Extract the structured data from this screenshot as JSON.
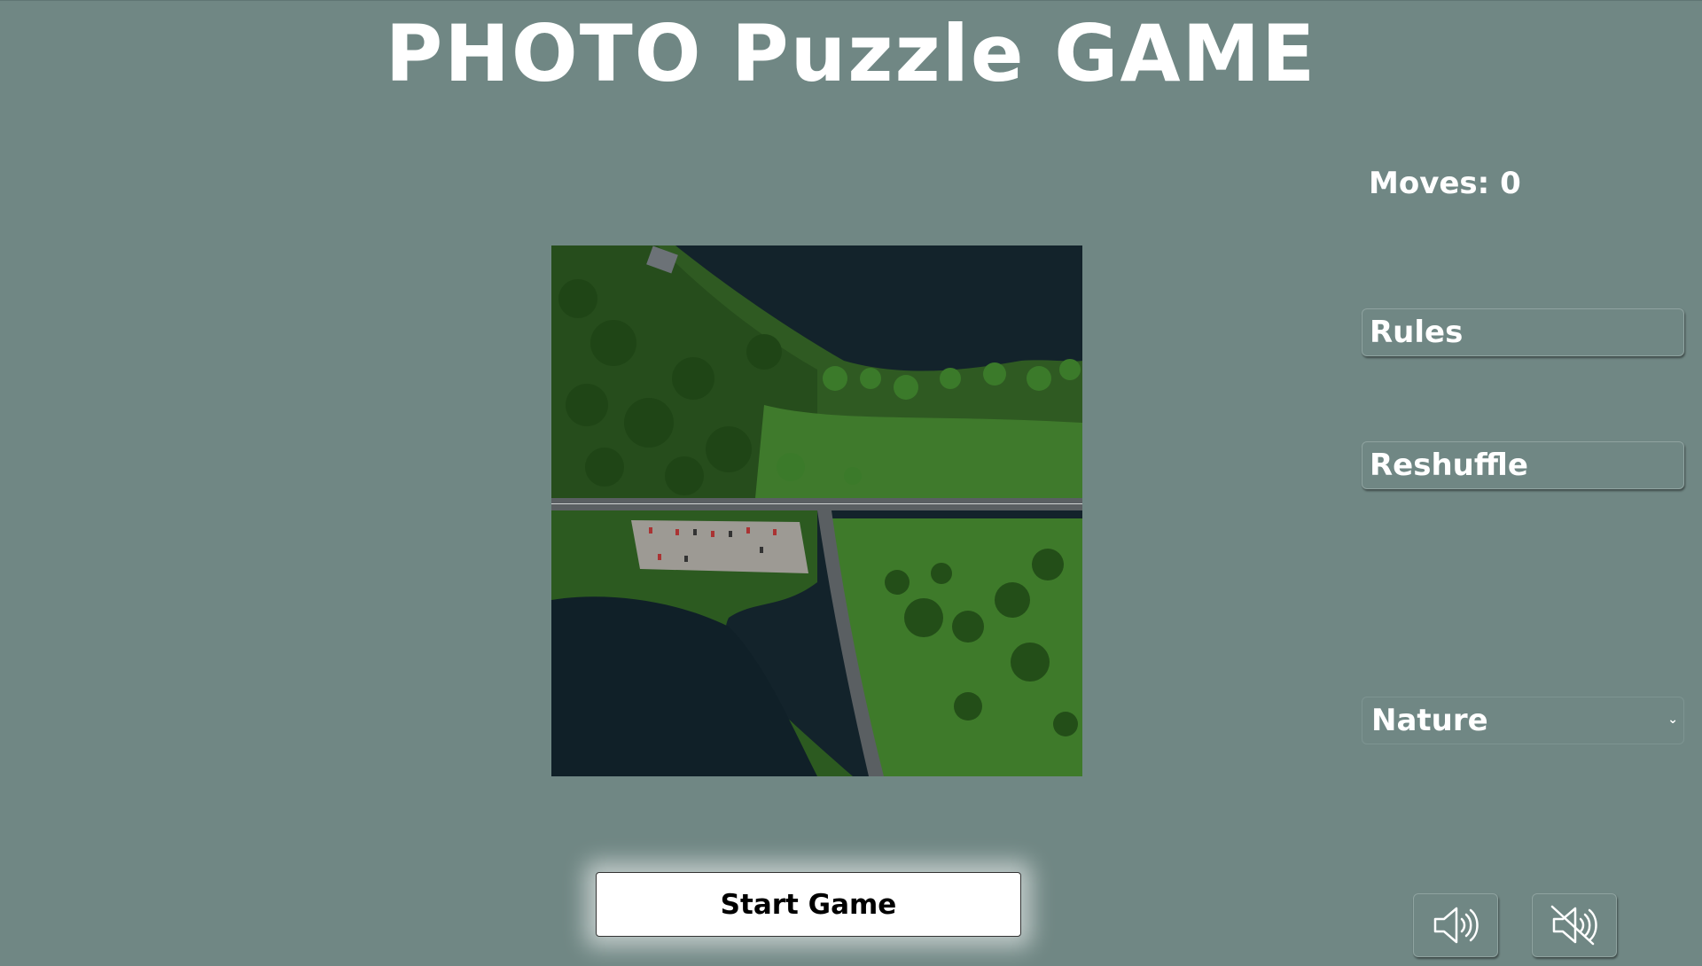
{
  "header": {
    "title": "PHOTO Puzzle GAME"
  },
  "stats": {
    "moves_label": "Moves: 0"
  },
  "controls": {
    "rules_label": "Rules",
    "reshuffle_label": "Reshuffle",
    "category_selected": "Nature",
    "start_label": "Start Game"
  },
  "sound": {
    "on_icon": "speaker-on-icon",
    "off_icon": "speaker-muted-icon"
  },
  "colors": {
    "background": "#708784",
    "text": "#ffffff",
    "start_button_bg": "#ffffff"
  }
}
